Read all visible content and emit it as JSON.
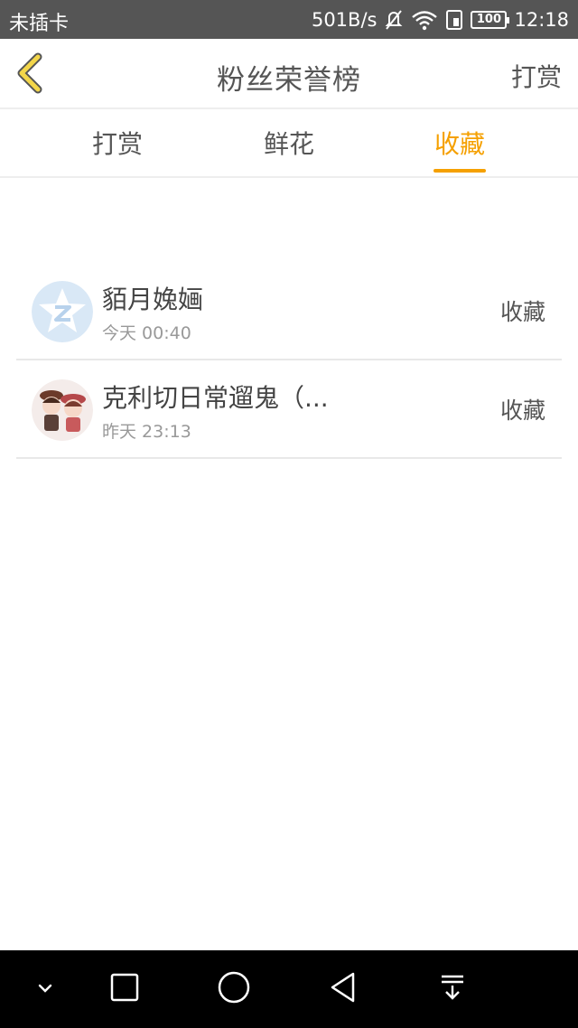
{
  "status_bar": {
    "carrier": "未插卡",
    "speed": "501B/s",
    "battery": "100",
    "time": "12:18"
  },
  "header": {
    "title": "粉丝荣誉榜",
    "action": "打赏"
  },
  "tabs": [
    {
      "label": "打赏",
      "active": false
    },
    {
      "label": "鲜花",
      "active": false
    },
    {
      "label": "收藏",
      "active": true
    }
  ],
  "accent_color": "#f5a000",
  "list": [
    {
      "name": "貊月婏婳",
      "time": "今天 00:40",
      "tag": "收藏",
      "avatar": "qq-default-avatar"
    },
    {
      "name": "克利切日常遛鬼（...",
      "time": "昨天 23:13",
      "tag": "收藏",
      "avatar": "anime-couple-avatar"
    }
  ],
  "nav_icons": [
    "chevron-down-icon",
    "square-icon",
    "circle-home-icon",
    "triangle-back-icon",
    "pull-down-icon"
  ]
}
